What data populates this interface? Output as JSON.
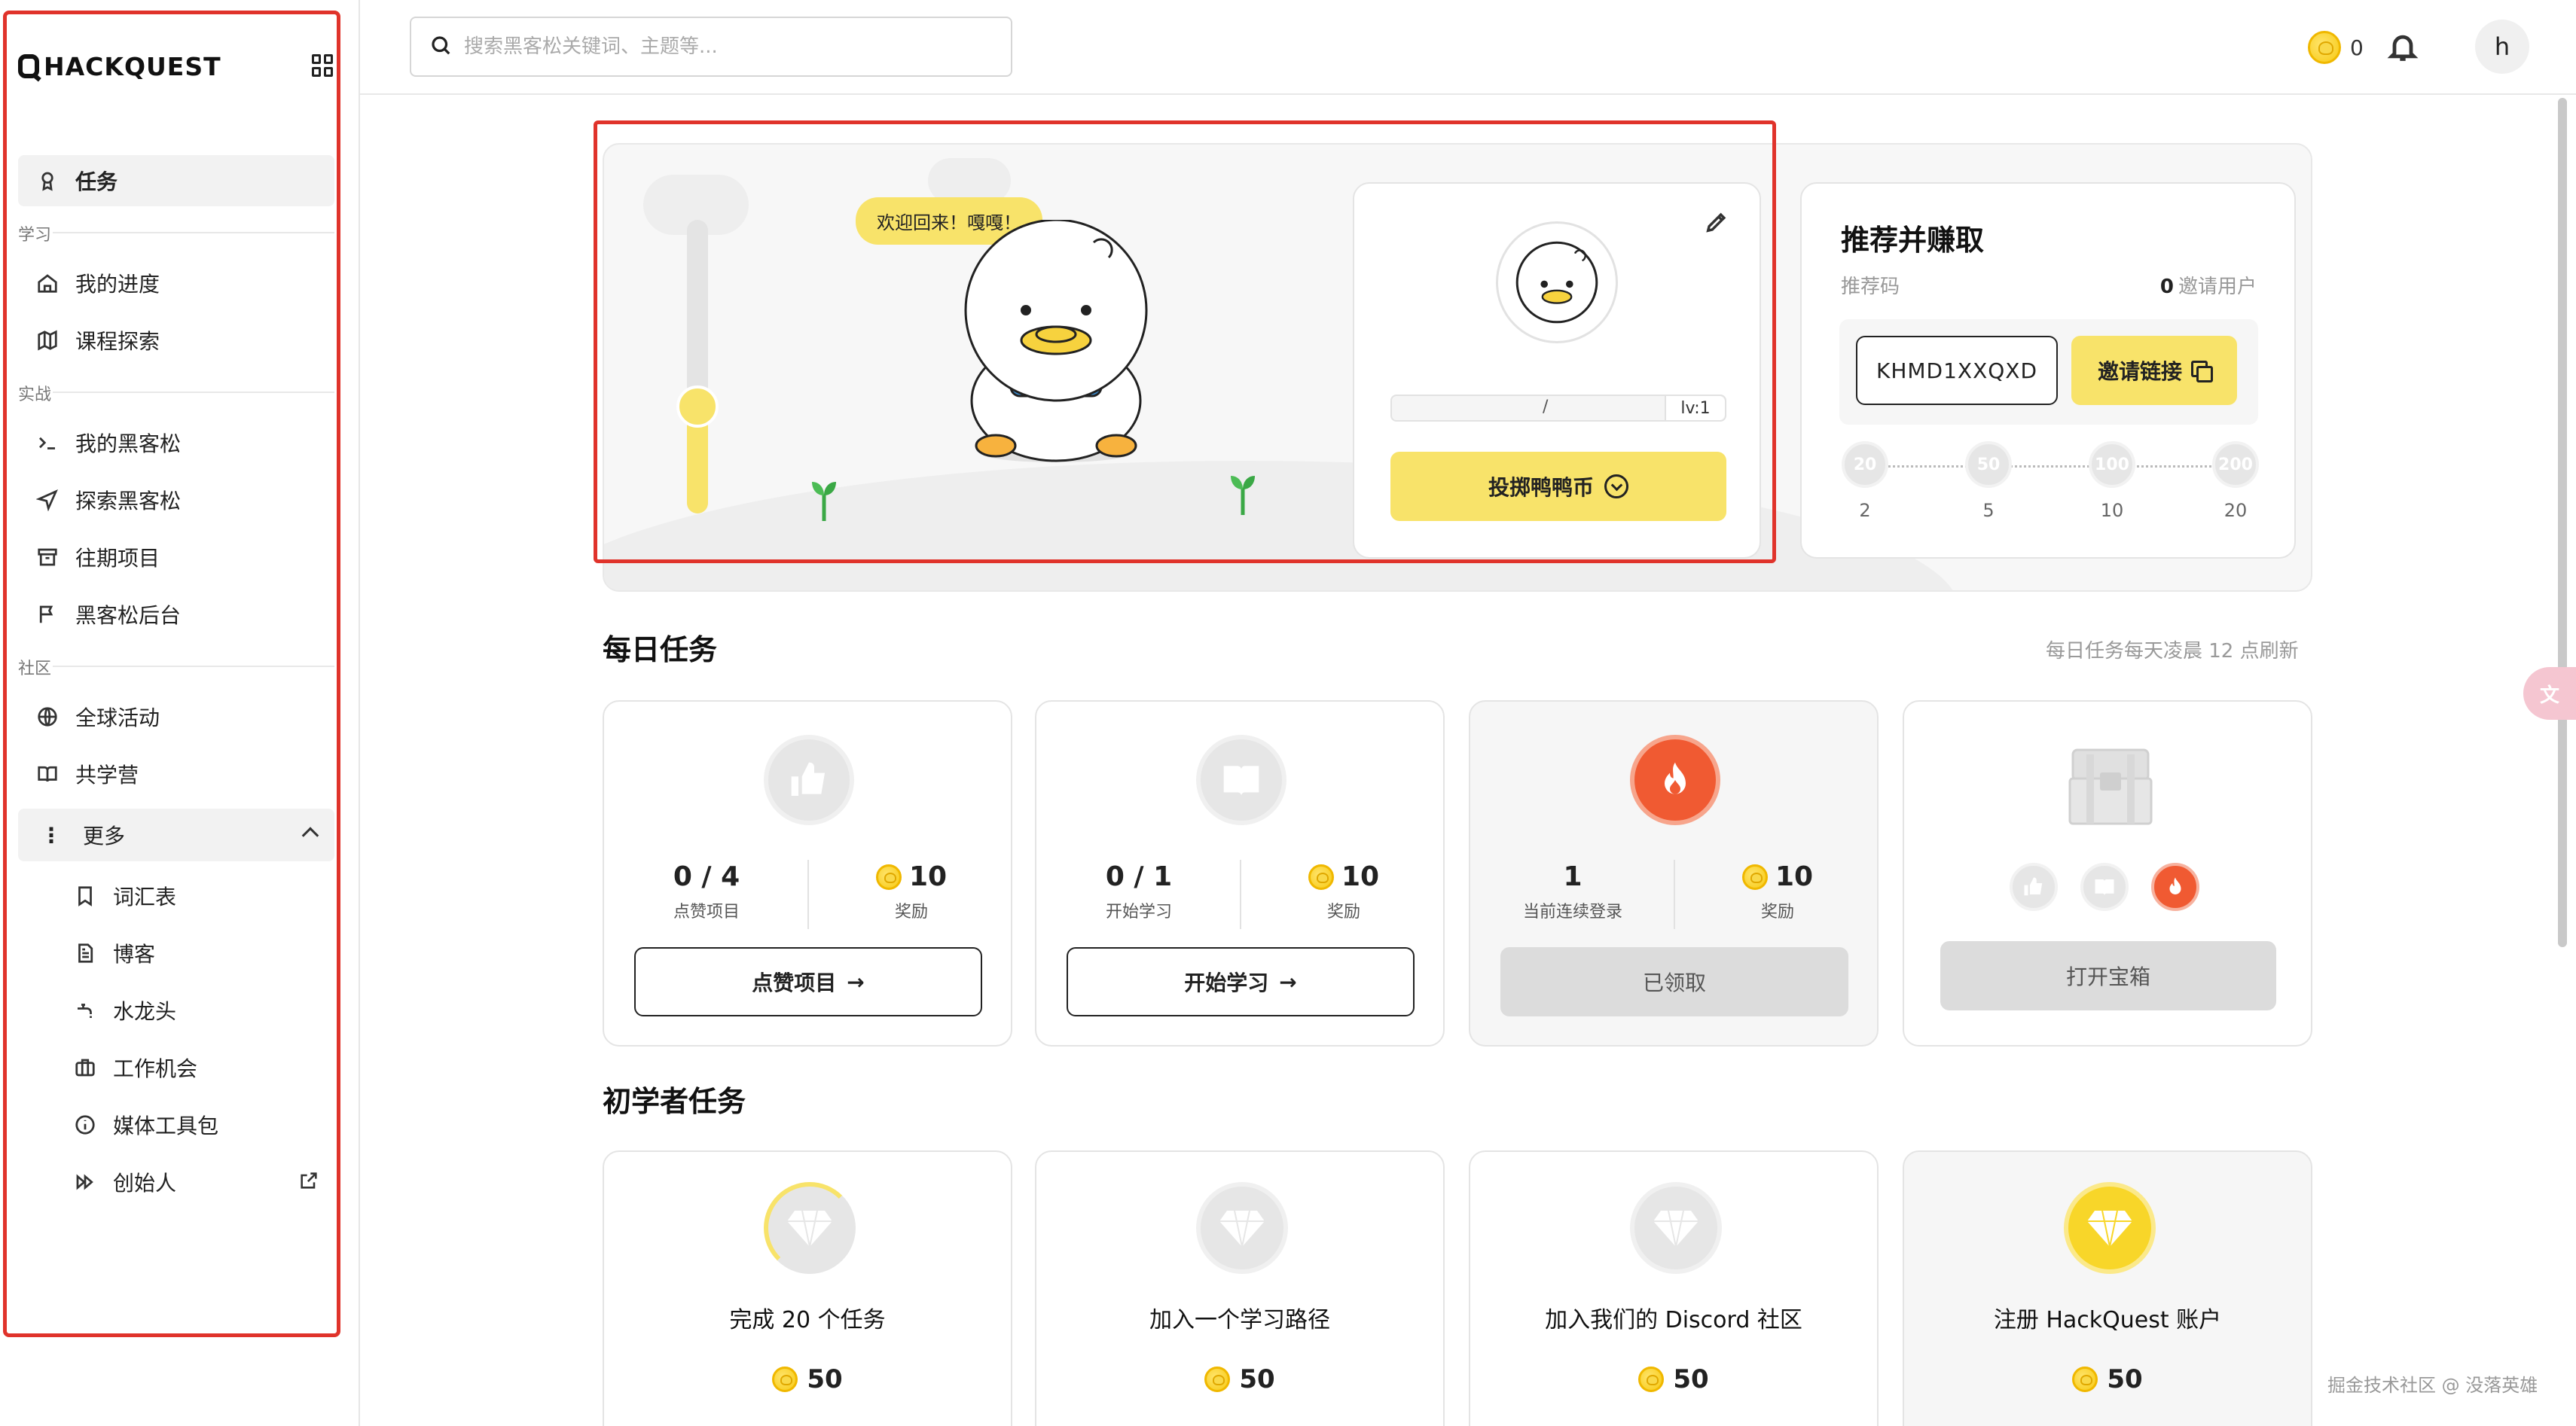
{
  "app": {
    "logo_text": "HACKQUEST"
  },
  "sidebar": {
    "active_item": {
      "label": "任务",
      "icon": "award-icon"
    },
    "sections": {
      "learn": "学习",
      "practice": "实战",
      "community": "社区"
    },
    "learn_items": [
      {
        "label": "我的进度",
        "icon": "home-icon"
      },
      {
        "label": "课程探索",
        "icon": "map-icon"
      }
    ],
    "practice_items": [
      {
        "label": "我的黑客松",
        "icon": "terminal-icon"
      },
      {
        "label": "探索黑客松",
        "icon": "navigation-icon"
      },
      {
        "label": "往期项目",
        "icon": "archive-icon"
      },
      {
        "label": "黑客松后台",
        "icon": "flag-icon"
      }
    ],
    "community_items": [
      {
        "label": "全球活动",
        "icon": "globe-icon"
      },
      {
        "label": "共学营",
        "icon": "book-open-icon"
      }
    ],
    "more": {
      "label": "更多"
    },
    "more_items": [
      {
        "label": "词汇表",
        "icon": "bookmark-icon"
      },
      {
        "label": "博客",
        "icon": "file-text-icon"
      },
      {
        "label": "水龙头",
        "icon": "faucet-icon"
      },
      {
        "label": "工作机会",
        "icon": "briefcase-icon"
      },
      {
        "label": "媒体工具包",
        "icon": "info-icon"
      },
      {
        "label": "创始人",
        "icon": "fast-forward-icon"
      }
    ]
  },
  "topbar": {
    "search_placeholder": "搜索黑客松关键词、主题等...",
    "coin_count": "0",
    "avatar_letter": "h"
  },
  "hero": {
    "bubble_text": "欢迎回来！嘎嘎！",
    "profile": {
      "level_separator": "/",
      "level_label": "lv:1",
      "throw_button": "投掷鸭鸭币"
    },
    "referral": {
      "title": "推荐并赚取",
      "code_label": "推荐码",
      "invites_count": "0",
      "invites_label": "邀请用户",
      "code": "KHMD1XXQXD",
      "invite_button": "邀请链接",
      "milestones": [
        {
          "coins": "20",
          "users": "2"
        },
        {
          "coins": "50",
          "users": "5"
        },
        {
          "coins": "100",
          "users": "10"
        },
        {
          "coins": "200",
          "users": "20"
        }
      ]
    }
  },
  "daily": {
    "title": "每日任务",
    "note": "每日任务每天凌晨 12 点刷新",
    "tasks": [
      {
        "progress": "0 / 4",
        "progress_label": "点赞项目",
        "reward": "10",
        "reward_label": "奖励",
        "button": "点赞项目",
        "icon": "thumbs-up-icon"
      },
      {
        "progress": "0 / 1",
        "progress_label": "开始学习",
        "reward": "10",
        "reward_label": "奖励",
        "button": "开始学习",
        "icon": "book-icon"
      },
      {
        "progress": "1",
        "progress_label": "当前连续登录",
        "reward": "10",
        "reward_label": "奖励",
        "button": "已领取",
        "icon": "flame-icon"
      }
    ],
    "chest": {
      "button": "打开宝箱",
      "icon": "treasure-chest-icon"
    }
  },
  "beginner": {
    "title": "初学者任务",
    "tasks": [
      {
        "title": "完成 20 个任务",
        "reward": "50"
      },
      {
        "title": "加入一个学习路径",
        "reward": "50"
      },
      {
        "title": "加入我们的 Discord 社区",
        "reward": "50"
      },
      {
        "title": "注册 HackQuest 账户",
        "reward": "50"
      }
    ]
  },
  "watermark": "掘金技术社区 @ 没落英雄",
  "colors": {
    "accent_yellow": "#f8e36a",
    "flame": "#f05a32",
    "highlight_red": "#e0332b"
  }
}
